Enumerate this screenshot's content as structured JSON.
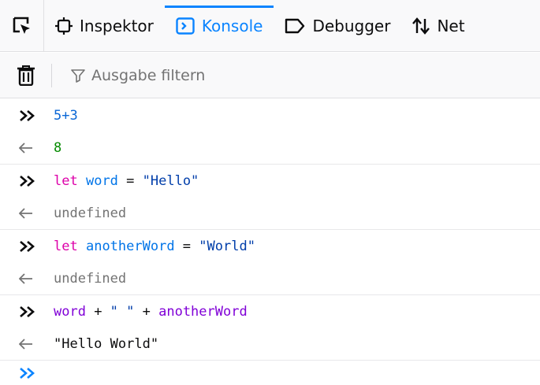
{
  "toolbar": {
    "tabs": [
      {
        "label": "Inspektor",
        "selected": false
      },
      {
        "label": "Konsole",
        "selected": true
      },
      {
        "label": "Debugger",
        "selected": false
      },
      {
        "label": "Net",
        "selected": false
      }
    ]
  },
  "filterbar": {
    "filter_placeholder": "Ausgabe filtern"
  },
  "console": {
    "entries": [
      {
        "type": "input",
        "tokens": [
          {
            "text": "5+3",
            "class": "num"
          }
        ]
      },
      {
        "type": "result",
        "text": "8",
        "class": "result-num"
      },
      {
        "type": "input",
        "tokens": [
          {
            "text": "let",
            "class": "kw"
          },
          {
            "text": " ",
            "class": "op"
          },
          {
            "text": "word",
            "class": "var"
          },
          {
            "text": " = ",
            "class": "op"
          },
          {
            "text": "\"Hello\"",
            "class": "str"
          }
        ]
      },
      {
        "type": "result",
        "text": "undefined",
        "class": "undef"
      },
      {
        "type": "input",
        "tokens": [
          {
            "text": "let",
            "class": "kw"
          },
          {
            "text": " ",
            "class": "op"
          },
          {
            "text": "anotherWord",
            "class": "var"
          },
          {
            "text": " = ",
            "class": "op"
          },
          {
            "text": "\"World\"",
            "class": "str"
          }
        ]
      },
      {
        "type": "result",
        "text": "undefined",
        "class": "undef"
      },
      {
        "type": "input",
        "tokens": [
          {
            "text": "word",
            "class": "fn"
          },
          {
            "text": " + ",
            "class": "op"
          },
          {
            "text": "\" \"",
            "class": "str"
          },
          {
            "text": " + ",
            "class": "op"
          },
          {
            "text": "anotherWord",
            "class": "fn"
          }
        ]
      },
      {
        "type": "result",
        "text": "\"Hello World\"",
        "class": "plain"
      }
    ]
  },
  "colors": {
    "accent": "#0a84ff",
    "keyword": "#dd00a9",
    "variable": "#0074e8",
    "string": "#003eaa",
    "result_number": "#058b00",
    "muted": "#737373"
  },
  "icons": {
    "picker": "element-picker-icon",
    "inspector": "inspector-icon",
    "console": "console-icon",
    "debugger": "debugger-icon",
    "network": "network-arrows-icon",
    "trash": "trash-icon",
    "filter": "filter-funnel-icon",
    "input_marker": "input-chevrons-icon",
    "result_marker": "result-arrow-icon"
  }
}
